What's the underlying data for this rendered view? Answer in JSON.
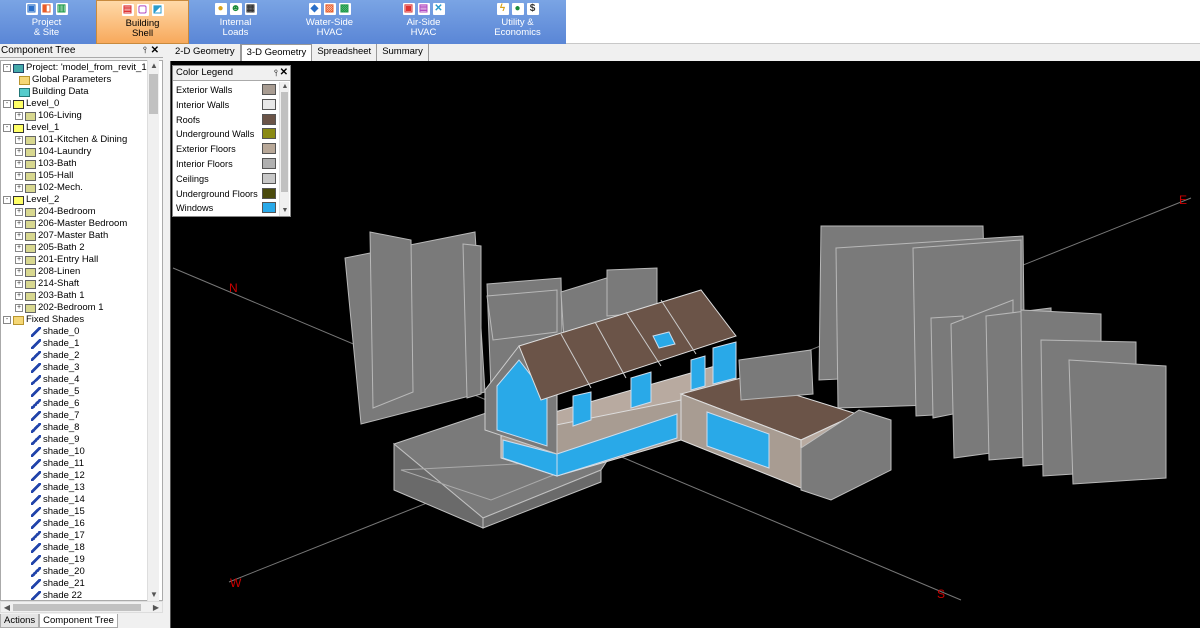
{
  "ribbon": {
    "tabs": [
      {
        "line1": "Project",
        "line2": "& Site",
        "icons": [
          "project-icon",
          "site-icon",
          "chart-icon"
        ]
      },
      {
        "line1": "Building",
        "line2": "Shell",
        "icons": [
          "wall-icon",
          "floor-icon",
          "roof-icon"
        ],
        "active": true
      },
      {
        "line1": "Internal",
        "line2": "Loads",
        "icons": [
          "lightbulb-icon",
          "people-icon",
          "equipment-icon"
        ]
      },
      {
        "line1": "Water-Side",
        "line2": "HVAC",
        "icons": [
          "pipe-icon",
          "boiler-icon",
          "chiller-icon"
        ]
      },
      {
        "line1": "Air-Side",
        "line2": "HVAC",
        "icons": [
          "ahu-icon",
          "duct-icon",
          "fan-icon"
        ]
      },
      {
        "line1": "Utility &",
        "line2": "Economics",
        "icons": [
          "electric-icon",
          "water-drop-icon",
          "dollar-icon"
        ]
      }
    ],
    "accent_color": "#6b96dd",
    "active_color": "#f7a95c"
  },
  "left_panel": {
    "title": "Component Tree",
    "pin_glyph": "⫯",
    "close_glyph": "✕",
    "tree": [
      {
        "label": "Project:  'model_from_revit_1'",
        "icon": "proj",
        "indent": 0,
        "toggle": "-"
      },
      {
        "label": "Global Parameters",
        "icon": "folder",
        "indent": 1,
        "toggle": ""
      },
      {
        "label": "Building Data",
        "icon": "bldg",
        "indent": 1,
        "toggle": ""
      },
      {
        "label": "Level_0",
        "icon": "level",
        "indent": 0,
        "toggle": "-"
      },
      {
        "label": "106-Living",
        "icon": "room",
        "indent": 1,
        "toggle": "+"
      },
      {
        "label": "Level_1",
        "icon": "level",
        "indent": 0,
        "toggle": "-"
      },
      {
        "label": "101-Kitchen & Dining",
        "icon": "room",
        "indent": 1,
        "toggle": "+"
      },
      {
        "label": "104-Laundry",
        "icon": "room",
        "indent": 1,
        "toggle": "+"
      },
      {
        "label": "103-Bath",
        "icon": "room",
        "indent": 1,
        "toggle": "+"
      },
      {
        "label": "105-Hall",
        "icon": "room",
        "indent": 1,
        "toggle": "+"
      },
      {
        "label": "102-Mech.",
        "icon": "room",
        "indent": 1,
        "toggle": "+"
      },
      {
        "label": "Level_2",
        "icon": "level",
        "indent": 0,
        "toggle": "-"
      },
      {
        "label": "204-Bedroom",
        "icon": "room",
        "indent": 1,
        "toggle": "+"
      },
      {
        "label": "206-Master Bedroom",
        "icon": "room",
        "indent": 1,
        "toggle": "+"
      },
      {
        "label": "207-Master Bath",
        "icon": "room",
        "indent": 1,
        "toggle": "+"
      },
      {
        "label": "205-Bath 2",
        "icon": "room",
        "indent": 1,
        "toggle": "+"
      },
      {
        "label": "201-Entry Hall",
        "icon": "room",
        "indent": 1,
        "toggle": "+"
      },
      {
        "label": "208-Linen",
        "icon": "room",
        "indent": 1,
        "toggle": "+"
      },
      {
        "label": "214-Shaft",
        "icon": "room",
        "indent": 1,
        "toggle": "+"
      },
      {
        "label": "203-Bath 1",
        "icon": "room",
        "indent": 1,
        "toggle": "+"
      },
      {
        "label": "202-Bedroom 1",
        "icon": "room",
        "indent": 1,
        "toggle": "+"
      },
      {
        "label": "Fixed Shades",
        "icon": "folder",
        "indent": 0,
        "toggle": "-"
      },
      {
        "label": "shade_0",
        "icon": "shade",
        "indent": 2,
        "toggle": ""
      },
      {
        "label": "shade_1",
        "icon": "shade",
        "indent": 2,
        "toggle": ""
      },
      {
        "label": "shade_2",
        "icon": "shade",
        "indent": 2,
        "toggle": ""
      },
      {
        "label": "shade_3",
        "icon": "shade",
        "indent": 2,
        "toggle": ""
      },
      {
        "label": "shade_4",
        "icon": "shade",
        "indent": 2,
        "toggle": ""
      },
      {
        "label": "shade_5",
        "icon": "shade",
        "indent": 2,
        "toggle": ""
      },
      {
        "label": "shade_6",
        "icon": "shade",
        "indent": 2,
        "toggle": ""
      },
      {
        "label": "shade_7",
        "icon": "shade",
        "indent": 2,
        "toggle": ""
      },
      {
        "label": "shade_8",
        "icon": "shade",
        "indent": 2,
        "toggle": ""
      },
      {
        "label": "shade_9",
        "icon": "shade",
        "indent": 2,
        "toggle": ""
      },
      {
        "label": "shade_10",
        "icon": "shade",
        "indent": 2,
        "toggle": ""
      },
      {
        "label": "shade_11",
        "icon": "shade",
        "indent": 2,
        "toggle": ""
      },
      {
        "label": "shade_12",
        "icon": "shade",
        "indent": 2,
        "toggle": ""
      },
      {
        "label": "shade_13",
        "icon": "shade",
        "indent": 2,
        "toggle": ""
      },
      {
        "label": "shade_14",
        "icon": "shade",
        "indent": 2,
        "toggle": ""
      },
      {
        "label": "shade_15",
        "icon": "shade",
        "indent": 2,
        "toggle": ""
      },
      {
        "label": "shade_16",
        "icon": "shade",
        "indent": 2,
        "toggle": ""
      },
      {
        "label": "shade_17",
        "icon": "shade",
        "indent": 2,
        "toggle": ""
      },
      {
        "label": "shade_18",
        "icon": "shade",
        "indent": 2,
        "toggle": ""
      },
      {
        "label": "shade_19",
        "icon": "shade",
        "indent": 2,
        "toggle": ""
      },
      {
        "label": "shade_20",
        "icon": "shade",
        "indent": 2,
        "toggle": ""
      },
      {
        "label": "shade_21",
        "icon": "shade",
        "indent": 2,
        "toggle": ""
      },
      {
        "label": "shade 22",
        "icon": "shade",
        "indent": 2,
        "toggle": ""
      }
    ],
    "bottom_tabs": [
      {
        "label": "Actions",
        "active": false
      },
      {
        "label": "Component Tree",
        "active": true
      }
    ]
  },
  "view_tabs": [
    {
      "label": "2-D Geometry",
      "active": false
    },
    {
      "label": "3-D Geometry",
      "active": true
    },
    {
      "label": "Spreadsheet",
      "active": false
    },
    {
      "label": "Summary",
      "active": false
    }
  ],
  "legend": {
    "title": "Color Legend",
    "pin_glyph": "⫯",
    "close_glyph": "✕",
    "items": [
      {
        "label": "Exterior Walls",
        "color": "#a89c92"
      },
      {
        "label": "Interior Walls",
        "color": "#e8e8e8"
      },
      {
        "label": "Roofs",
        "color": "#6b5448"
      },
      {
        "label": "Underground Walls",
        "color": "#8a8a14"
      },
      {
        "label": "Exterior Floors",
        "color": "#b8a898"
      },
      {
        "label": "Interior Floors",
        "color": "#b0b0b0"
      },
      {
        "label": "Ceilings",
        "color": "#c8c8c8"
      },
      {
        "label": "Underground Floors",
        "color": "#4a4a0c"
      },
      {
        "label": "Windows",
        "color": "#29a9e8"
      }
    ]
  },
  "compass": {
    "north": "N",
    "south": "S",
    "east": "E",
    "west": "W",
    "color": "#cc0000"
  }
}
